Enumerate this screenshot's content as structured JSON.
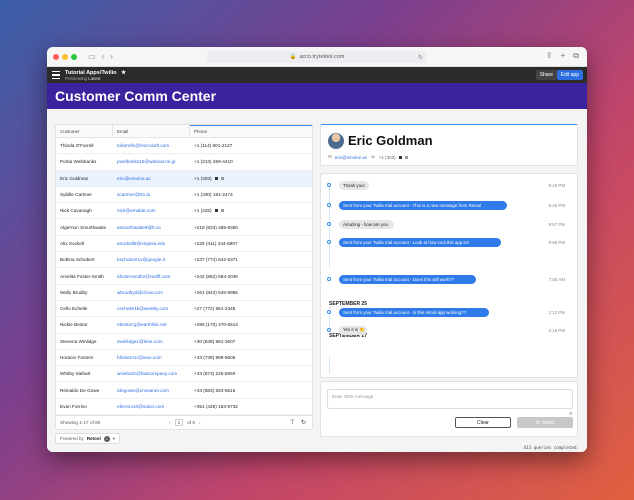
{
  "browser": {
    "url": "acco.tryretool.com",
    "colors": {
      "close": "#ff5f57",
      "minimize": "#febc2e",
      "maximize": "#28c840"
    }
  },
  "app_header": {
    "title": "Tutorial Apps/Twilio",
    "star": "★",
    "subtitle_prefix": "Previewing",
    "subtitle_version": "Latest",
    "share_label": "Share",
    "edit_label": "Edit app"
  },
  "banner": {
    "title": "Customer Comm Center"
  },
  "table": {
    "columns": [
      "Customer",
      "Email",
      "Phone"
    ],
    "rows": [
      {
        "name": "Thinda O'Farrell",
        "email": "tofarrell1@microsoft.com",
        "phone": "+1 (114) 801-2127"
      },
      {
        "name": "Portia Welsbanks",
        "email": "pwelbanks16@wdavar.ne.jp",
        "phone": "+1 (213) 269-4410"
      },
      {
        "name": "Eric Goldman",
        "email": "eric@smoine.ac",
        "phone": "+1 (303)"
      },
      {
        "name": "Sybille Cartmer",
        "email": "scartmer@51.la",
        "phone": "+1 (330) 181-2474"
      },
      {
        "name": "Nick Cavanagh",
        "email": "nick@emable.com",
        "phone": "+1 (425)"
      },
      {
        "name": "Algernon Smurthwaite",
        "email": "asmurthwaite8@lt.ce",
        "phone": "+218 (833) 485-8360"
      },
      {
        "name": "Alix Sockell",
        "email": "asockell8@virginia.edu",
        "phone": "+225 (411) 344-6907"
      },
      {
        "name": "Bobina Schubert",
        "email": "bschubert1v@google.it",
        "phone": "+237 (774) 642-5371"
      },
      {
        "name": "Amelita Foster-Smith",
        "email": "afostersmith2@rediff.com",
        "phone": "+242 (852) 684-2036"
      },
      {
        "name": "Wally Brudby",
        "email": "wbrudbyd@chow.com",
        "phone": "+261 (843) 545-9965"
      },
      {
        "name": "Cello Echelle",
        "email": "cechelle1k@weebly.com",
        "phone": "+27 (772) 951-2348"
      },
      {
        "name": "Nickie Bestor",
        "email": "nbestor1j@earthlink.net",
        "phone": "+299 (170) 470-5514"
      },
      {
        "name": "Stevena Winlidge",
        "email": "swinlidge1@time.com",
        "phone": "+30 (848) 961-3607"
      },
      {
        "name": "Horacio Fontem",
        "email": "hfontem1r@ivao.com",
        "phone": "+33 (739) 999-9605"
      },
      {
        "name": "Whitby Siebart",
        "email": "wsiebartr@fastcompany.com",
        "phone": "+33 (873) 225-5650"
      },
      {
        "name": "Reinaldo De Gowe",
        "email": "rdegowe@cnnsanet.com",
        "phone": "+33 (883) 583-5616"
      },
      {
        "name": "Evan Forrino",
        "email": "eferrino10@salon.com",
        "phone": "+351 (428) 183-9732"
      }
    ],
    "footer": {
      "showing": "Showing 1-17 of 80",
      "page": "1",
      "of": "of 5"
    }
  },
  "powered": {
    "prefix": "Powered by",
    "brand": "Retool",
    "badge": "C"
  },
  "profile": {
    "name": "Eric Goldman",
    "email": "eric@smoine.ac",
    "phone": "+1 (303)"
  },
  "chat": {
    "messages": [
      {
        "text": "Thank you!",
        "dir": "in",
        "time": "8:49 PM"
      },
      {
        "text": "Sent from your Twilio trial account - This is a new message from Retool",
        "dir": "out",
        "time": "9:48 PM"
      },
      {
        "text": "Amazing - how are you",
        "dir": "in",
        "time": "9:57 PM"
      },
      {
        "text": "Sent from your Twilio trial account - Look at how cool this app is!!",
        "dir": "out",
        "time": "9:58 PM"
      },
      {
        "text": "Sent from your Twilio trial account - Does this still work??",
        "dir": "out",
        "time": "7:56 AM"
      },
      {
        "text": "Sent from your Twilio trial account - Is this retool app working??",
        "dir": "out",
        "time": "2:12 PM"
      },
      {
        "text": "Yes it is 👏",
        "dir": "in",
        "time": "2:16 PM"
      }
    ],
    "dates": [
      "SEPTEMBER 25",
      "SEPTEMBER 27"
    ]
  },
  "composer": {
    "placeholder": "Enter SMS message",
    "count": "0",
    "clear_label": "Clear",
    "send_label": "Send"
  },
  "status": {
    "text": "413 queries completed."
  }
}
